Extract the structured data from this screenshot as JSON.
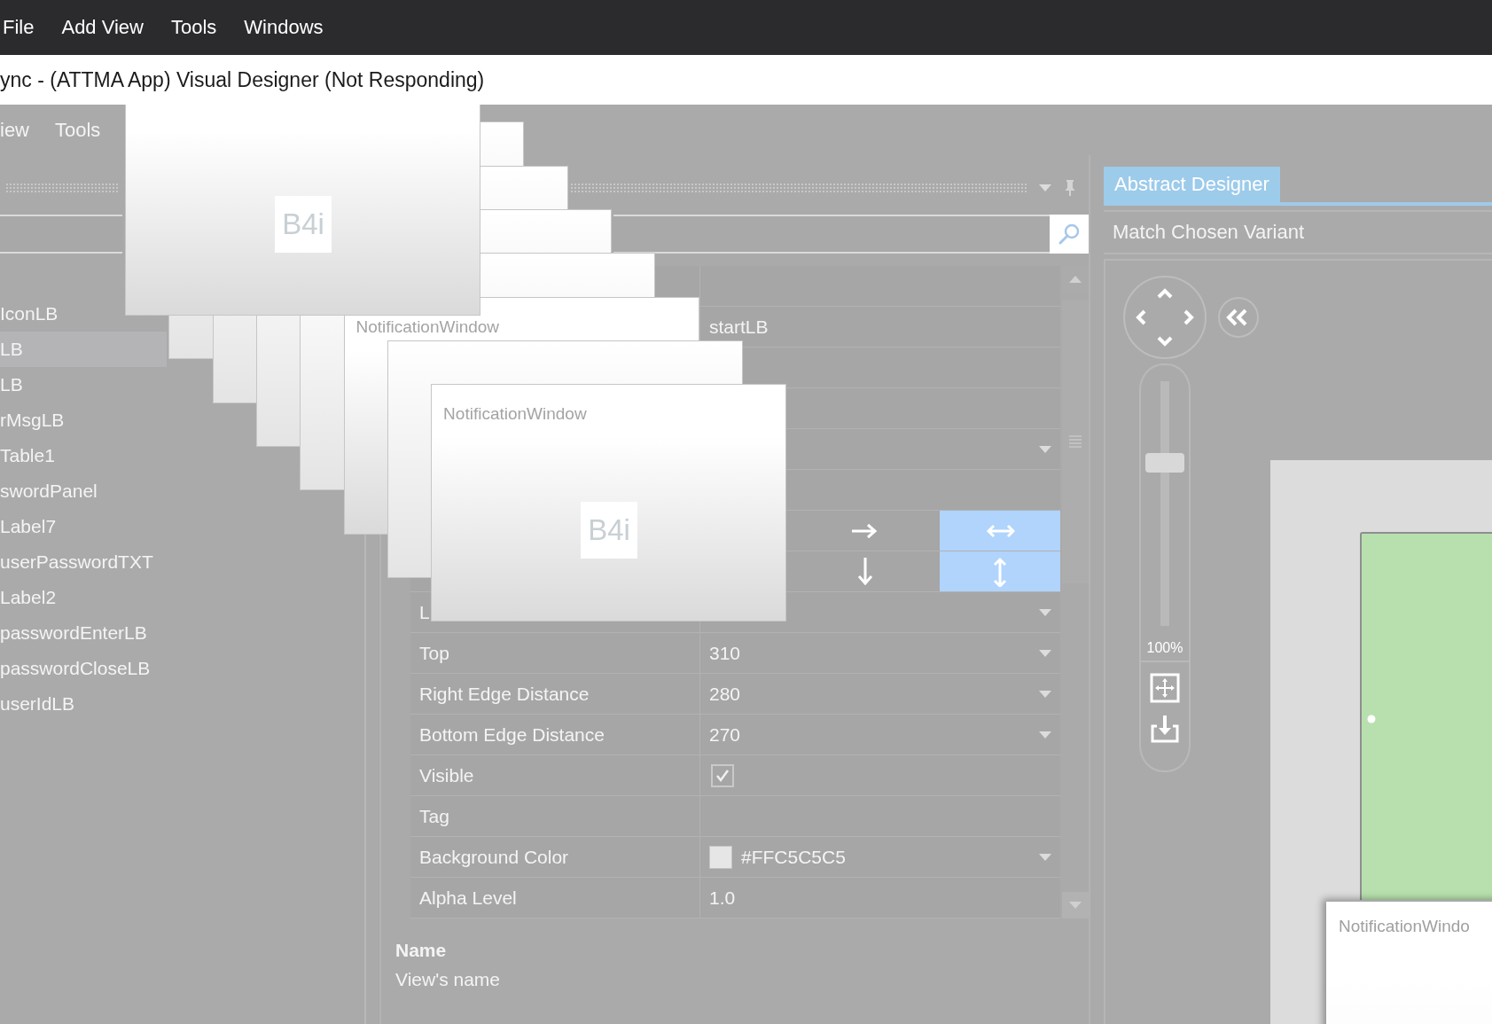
{
  "menu_bar": {
    "items": [
      "File",
      "Add View",
      "Tools",
      "Windows"
    ]
  },
  "window": {
    "title": "ync - (ATTMA App) Visual Designer (Not Responding)"
  },
  "inner_menu": {
    "items": [
      "iew",
      "Tools"
    ]
  },
  "views_tree": {
    "items": [
      {
        "label": "IconLB",
        "selected": false
      },
      {
        "label": "LB",
        "selected": true
      },
      {
        "label": "LB",
        "selected": false
      },
      {
        "label": "rMsgLB",
        "selected": false
      },
      {
        "label": "Table1",
        "selected": false
      },
      {
        "label": "swordPanel",
        "selected": false
      },
      {
        "label": "Label7",
        "selected": false
      },
      {
        "label": "userPasswordTXT",
        "selected": false
      },
      {
        "label": "Label2",
        "selected": false
      },
      {
        "label": "passwordEnterLB",
        "selected": false
      },
      {
        "label": "passwordCloseLB",
        "selected": false
      },
      {
        "label": "userIdLB",
        "selected": false
      }
    ]
  },
  "properties": {
    "rows": [
      {
        "kind": "text"
      },
      {
        "kind": "text",
        "value": "startLB"
      },
      {
        "kind": "text"
      },
      {
        "kind": "text"
      },
      {
        "kind": "dropdown"
      },
      {
        "kind": "text"
      },
      {
        "kind": "hanchor",
        "options": [
          {
            "selected": false
          },
          {
            "selected": true
          }
        ]
      },
      {
        "kind": "vanchor",
        "options": [
          {
            "selected": false
          },
          {
            "selected": true
          }
        ]
      },
      {
        "kind": "dropdown",
        "name": "L"
      },
      {
        "kind": "dropdown",
        "name": "Top",
        "value": "310"
      },
      {
        "kind": "dropdown",
        "name": "Right Edge Distance",
        "value": "280"
      },
      {
        "kind": "dropdown",
        "name": "Bottom Edge Distance",
        "value": "270"
      },
      {
        "kind": "check",
        "name": "Visible",
        "checked": true
      },
      {
        "kind": "text",
        "name": "Tag"
      },
      {
        "kind": "color",
        "name": "Background Color",
        "value": "#FFC5C5C5"
      },
      {
        "kind": "text",
        "name": "Alpha Level",
        "value": "1.0"
      }
    ],
    "description": {
      "title": "Name",
      "text": "View's name"
    }
  },
  "designer": {
    "tab": {
      "label": "Abstract Designer",
      "selected": true
    },
    "variant": "Match Chosen Variant",
    "zoom": {
      "level": 0.68,
      "reading": "100%"
    },
    "canvas_window": {
      "title": "NotificationWindo"
    }
  },
  "ghost_windows": [
    {
      "kind": "full",
      "logo": "B4i"
    },
    {
      "kind": "blank"
    },
    {
      "kind": "blank"
    },
    {
      "kind": "blank"
    },
    {
      "kind": "blank"
    },
    {
      "kind": "full",
      "title": "NotificationWindow"
    },
    {
      "kind": "blank"
    },
    {
      "kind": "full",
      "title": "NotificationWindow",
      "logo": "B4i"
    }
  ]
}
